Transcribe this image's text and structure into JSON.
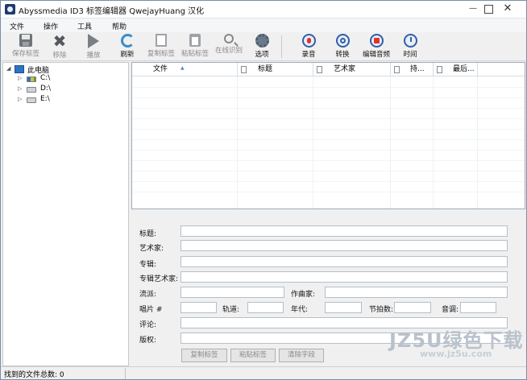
{
  "window": {
    "title": "Abyssmedia ID3 标签编辑器 QwejayHuang 汉化",
    "min": "—",
    "max": "□",
    "close": "✕"
  },
  "menu": [
    "文件",
    "操作",
    "工具",
    "帮助"
  ],
  "toolbar": [
    {
      "label": "保存标签",
      "icon": "save-icon",
      "enabled": false
    },
    {
      "label": "移除",
      "icon": "remove-icon",
      "enabled": false
    },
    {
      "label": "播放",
      "icon": "play-icon",
      "enabled": false
    },
    {
      "label": "刷新",
      "icon": "refresh-icon",
      "enabled": true
    },
    {
      "label": "复制标签",
      "icon": "copy-icon",
      "enabled": false
    },
    {
      "label": "粘贴标签",
      "icon": "paste-icon",
      "enabled": false
    },
    {
      "label": "在线识别",
      "icon": "search-icon",
      "enabled": false
    },
    {
      "label": "选项",
      "icon": "gear-icon",
      "enabled": true
    },
    {
      "label": "录音",
      "icon": "record-icon",
      "enabled": true
    },
    {
      "label": "转换",
      "icon": "convert-icon",
      "enabled": true
    },
    {
      "label": "编辑音频",
      "icon": "edit-audio-icon",
      "enabled": true
    },
    {
      "label": "时间",
      "icon": "clock-icon",
      "enabled": true
    }
  ],
  "tree": {
    "root": "此电脑",
    "drives": [
      "C:\\",
      "D:\\",
      "E:\\"
    ],
    "expander": "▷",
    "root_expander": "◢"
  },
  "grid": {
    "columns": [
      "文件",
      "标题",
      "艺术家",
      "持...",
      "最后..."
    ],
    "sort_indicator": "▲"
  },
  "fields": {
    "title": "标题:",
    "artist": "艺术家:",
    "album": "专辑:",
    "album_artist": "专辑艺术家:",
    "genre": "流派:",
    "composer": "作曲家:",
    "disc": "唱片 #",
    "track": "轨道:",
    "year": "年代:",
    "bpm": "节拍数:",
    "key": "音调:",
    "comment": "评论:",
    "copyright": "版权:"
  },
  "buttons": {
    "copy_tag": "复制标签",
    "paste_tag": "粘贴标签",
    "clear_fields": "清除字段"
  },
  "status": {
    "total_files": "找到的文件总数: 0"
  },
  "watermark": {
    "big": "JZ5U绿色下载",
    "small": "www.jz5u.com"
  }
}
